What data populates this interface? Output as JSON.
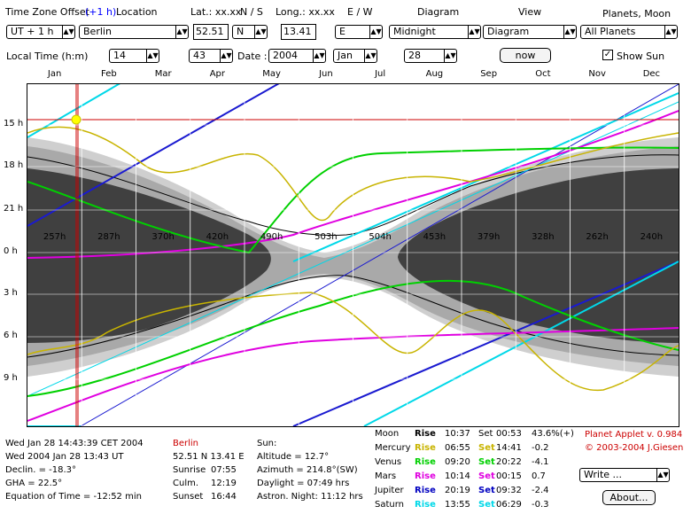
{
  "header": {
    "tz_label": "Time Zone Offset",
    "tz_offset": "(+1 h)",
    "location_label": "Location",
    "lat_label": "Lat.: xx.xx",
    "ns_label": "N / S",
    "long_label": "Long.: xx.xx",
    "ew_label": "E / W",
    "diagram_label": "Diagram",
    "view_label": "View",
    "planets_label": "Planets, Moon",
    "local_time_label": "Local Time (h:m)",
    "date_label": "Date :"
  },
  "controls": {
    "tz_select": "UT + 1 h",
    "location_select": "Berlin",
    "lat_value": "52.51",
    "ns_select": "N",
    "long_value": "13.41",
    "ew_select": "E",
    "diagram_select": "Midnight",
    "view_select": "Diagram",
    "planets_select": "All Planets",
    "hour_select": "14",
    "minute_select": "43",
    "year_select": "2004",
    "month_select": "Jan",
    "day_select": "28",
    "now_button": "now",
    "show_sun_label": "Show Sun",
    "show_sun_checked": true
  },
  "months": [
    "Jan",
    "Feb",
    "Mar",
    "Apr",
    "May",
    "Jun",
    "Jul",
    "Aug",
    "Sep",
    "Oct",
    "Nov",
    "Dec"
  ],
  "hour_ticks": [
    "15 h",
    "18 h",
    "21 h",
    "0 h",
    "3 h",
    "6 h",
    "9 h"
  ],
  "darkness_hours": [
    "257h",
    "287h",
    "370h",
    "420h",
    "490h",
    "503h",
    "504h",
    "453h",
    "379h",
    "328h",
    "262h",
    "240h"
  ],
  "info": {
    "datetime_local": "Wed Jan 28 14:43:39 CET 2004",
    "datetime_ut": "Wed 2004 Jan 28 13:43 UT",
    "declination": "Declin. = -18.3°",
    "gha": "GHA = 22.5°",
    "eq_of_time": "Equation of Time = -12:52 min",
    "city": "Berlin",
    "coords": "52.51 N  13.41 E",
    "sunrise_label": "Sunrise",
    "sunrise": "07:55",
    "culm_label": "Culm.",
    "culm": "12:19",
    "sunset_label": "Sunset",
    "sunset": "16:44",
    "sun_label": "Sun:",
    "altitude": "Altitude = 12.7°",
    "azimuth": "Azimuth = 214.8°(SW)",
    "daylight": "Daylight = 07:49 hrs",
    "astron_night": "Astron. Night: 11:12 hrs"
  },
  "planets_table": [
    {
      "name": "Moon",
      "rise": "Rise",
      "rise_time": "10:37",
      "set": "Set",
      "set_time": "00:53",
      "extra": "43.6%(+)",
      "color": "#000000"
    },
    {
      "name": "Mercury",
      "rise": "Rise",
      "rise_time": "06:55",
      "set": "Set",
      "set_time": "14:41",
      "extra": "-0.2",
      "color": "#c8b400"
    },
    {
      "name": "Venus",
      "rise": "Rise",
      "rise_time": "09:20",
      "set": "Set",
      "set_time": "20:22",
      "extra": "-4.1",
      "color": "#00d000"
    },
    {
      "name": "Mars",
      "rise": "Rise",
      "rise_time": "10:14",
      "set": "Set",
      "set_time": "00:15",
      "extra": "0.7",
      "color": "#e000e0"
    },
    {
      "name": "Jupiter",
      "rise": "Rise",
      "rise_time": "20:19",
      "set": "Set",
      "set_time": "09:32",
      "extra": "-2.4",
      "color": "#0000c0"
    },
    {
      "name": "Saturn",
      "rise": "Rise",
      "rise_time": "13:55",
      "set": "Set",
      "set_time": "06:29",
      "extra": "-0.3",
      "color": "#00d8e8"
    }
  ],
  "credits": {
    "version": "Planet Applet v. 0.984",
    "copyright": "© 2003-2004 J.Giesen"
  },
  "write_select": "Write ...",
  "about_button": "About...",
  "colors": {
    "dark": "#404040",
    "gray": "#a0a0a0",
    "light": "#cccccc",
    "red": "#cc0000",
    "sun": "#ffff00"
  }
}
